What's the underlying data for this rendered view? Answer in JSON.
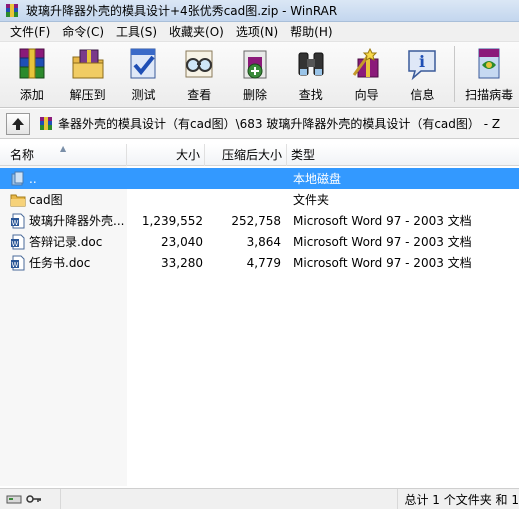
{
  "window": {
    "title": "玻璃升降器外壳的模具设计+4张优秀cad图.zip - WinRAR"
  },
  "menu": [
    {
      "label": "文件(F)"
    },
    {
      "label": "命令(C)"
    },
    {
      "label": "工具(S)"
    },
    {
      "label": "收藏夹(O)"
    },
    {
      "label": "选项(N)"
    },
    {
      "label": "帮助(H)"
    }
  ],
  "toolbar": {
    "add": "添加",
    "extract_to": "解压到",
    "test": "测试",
    "view": "查看",
    "delete": "删除",
    "find": "查找",
    "wizard": "向导",
    "info": "信息",
    "virus_scan": "扫描病毒"
  },
  "address": {
    "path": "夆器外壳的模具设计（有cad图）\\683 玻璃升降器外壳的模具设计（有cad图） - Z"
  },
  "columns": {
    "name": "名称",
    "size": "大小",
    "packed": "压缩后大小",
    "type": "类型"
  },
  "files": [
    {
      "name": "..",
      "size": "",
      "packed": "",
      "type": "本地磁盘",
      "icon": "drive-icon"
    },
    {
      "name": "cad图",
      "size": "",
      "packed": "",
      "type": "文件夹",
      "icon": "folder-icon"
    },
    {
      "name": "玻璃升降器外壳...",
      "size": "1,239,552",
      "packed": "252,758",
      "type": "Microsoft Word 97 - 2003 文档",
      "icon": "doc-icon"
    },
    {
      "name": "答辩记录.doc",
      "size": "23,040",
      "packed": "3,864",
      "type": "Microsoft Word 97 - 2003 文档",
      "icon": "doc-icon"
    },
    {
      "name": "任务书.doc",
      "size": "33,280",
      "packed": "4,779",
      "type": "Microsoft Word 97 - 2003 文档",
      "icon": "doc-icon"
    }
  ],
  "status": {
    "summary": "总计 1 个文件夹 和 1"
  },
  "colors": {
    "selection": "#3399ff",
    "title_bg": "#c3d6ee"
  }
}
